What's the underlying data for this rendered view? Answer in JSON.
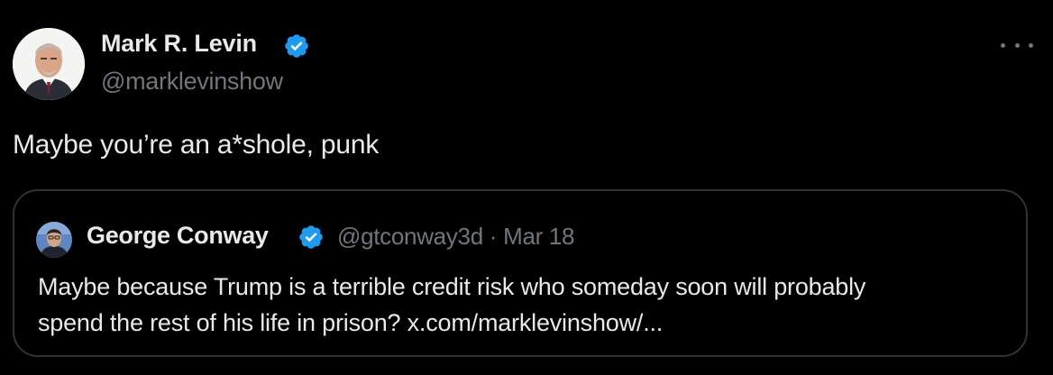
{
  "colors": {
    "background": "#000000",
    "primary_text": "#e7e9ea",
    "secondary_text": "#71767b",
    "verified_badge": "#1d9bf0",
    "card_border": "#2f3336"
  },
  "tweet": {
    "author": {
      "name": "Mark R. Levin",
      "handle": "@marklevinshow",
      "verified_icon": "verified-badge-icon"
    },
    "more_icon": "more-dots-icon",
    "text": "Maybe you’re an a*shole, punk",
    "quote": {
      "author": {
        "name": "George Conway",
        "handle": "@gtconway3d",
        "separator": "·",
        "date": "Mar 18",
        "verified_icon": "verified-badge-icon"
      },
      "text_lines": [
        "Maybe because Trump is a terrible credit risk who someday soon will probably",
        "spend the rest of his life in prison? x.com/marklevinshow/..."
      ]
    }
  }
}
